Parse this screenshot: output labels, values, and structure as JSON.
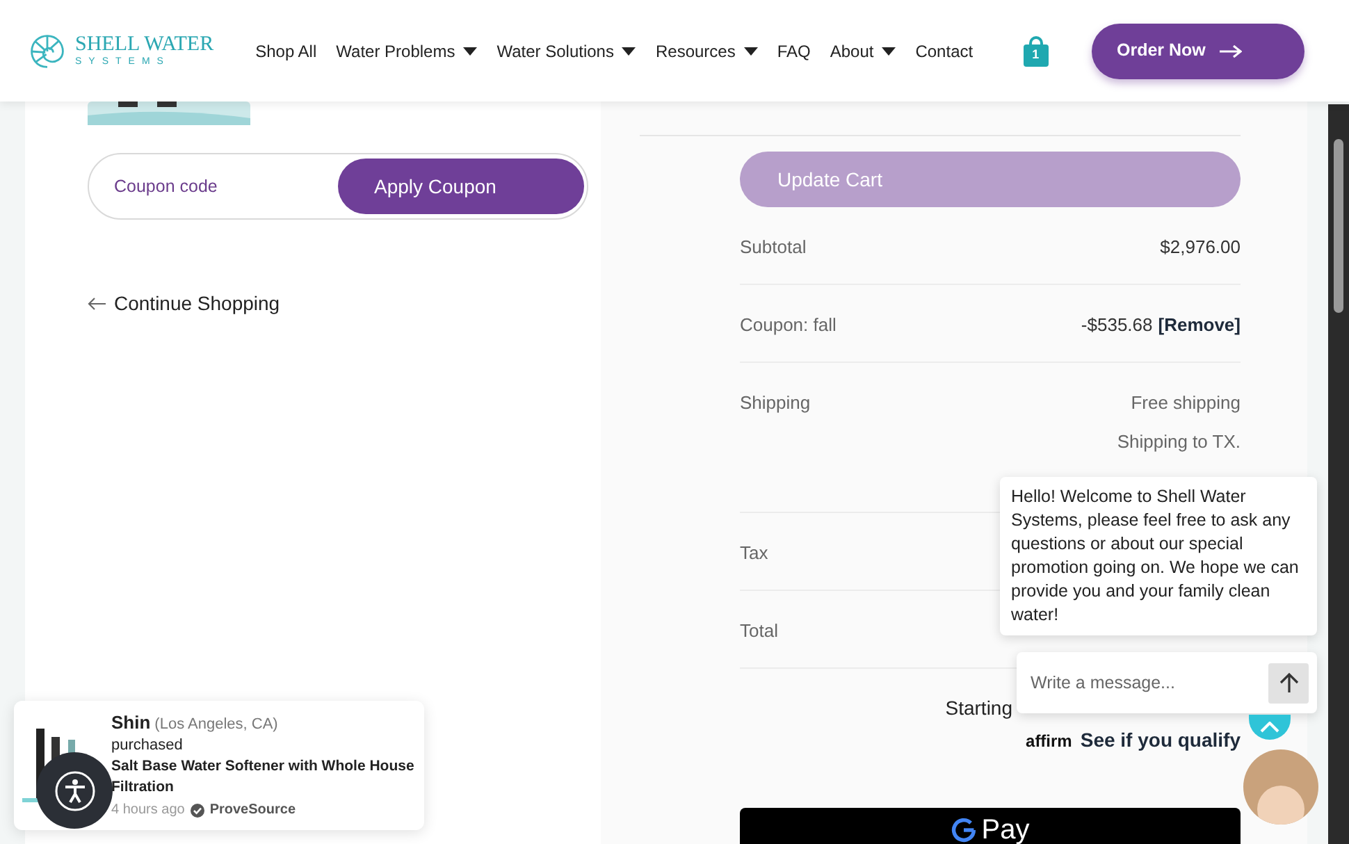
{
  "header": {
    "logo": {
      "name": "SHELL WATER",
      "tagline": "SYSTEMS"
    },
    "nav": [
      {
        "label": "Shop All",
        "dropdown": false
      },
      {
        "label": "Water Problems",
        "dropdown": true
      },
      {
        "label": "Water Solutions",
        "dropdown": true
      },
      {
        "label": "Resources",
        "dropdown": true
      },
      {
        "label": "FAQ",
        "dropdown": false
      },
      {
        "label": "About",
        "dropdown": true
      },
      {
        "label": "Contact",
        "dropdown": false
      }
    ],
    "cart_count": "1",
    "cta": "Order Now"
  },
  "coupon": {
    "placeholder": "Coupon code",
    "button": "Apply Coupon"
  },
  "continue_shopping": "Continue Shopping",
  "totals": {
    "update_button": "Update Cart",
    "update_disabled": true,
    "rows": [
      {
        "label": "Subtotal",
        "value": "$2,976.00"
      },
      {
        "label": "Coupon: fall",
        "value": "-$535.68",
        "action": "[Remove]"
      },
      {
        "label": "Shipping",
        "lines": [
          "Free shipping",
          "Shipping to TX."
        ]
      },
      {
        "label": "Tax"
      },
      {
        "label": "Total"
      }
    ],
    "affirm": {
      "text": "Starting",
      "logo": "affirm",
      "link": "See if you qualify"
    },
    "gpay": "Pay"
  },
  "chat": {
    "message": "Hello! Welcome to Shell Water Systems, please feel free to ask any questions or about our special promotion going on. We hope we can provide you and your family clean water!",
    "placeholder": "Write a message..."
  },
  "notification": {
    "name": "Shin",
    "location": "(Los Angeles, CA)",
    "action": "purchased",
    "product": "Salt Base Water Softener with Whole House Filtration",
    "time": "4 hours ago",
    "source": "ProveSource"
  }
}
